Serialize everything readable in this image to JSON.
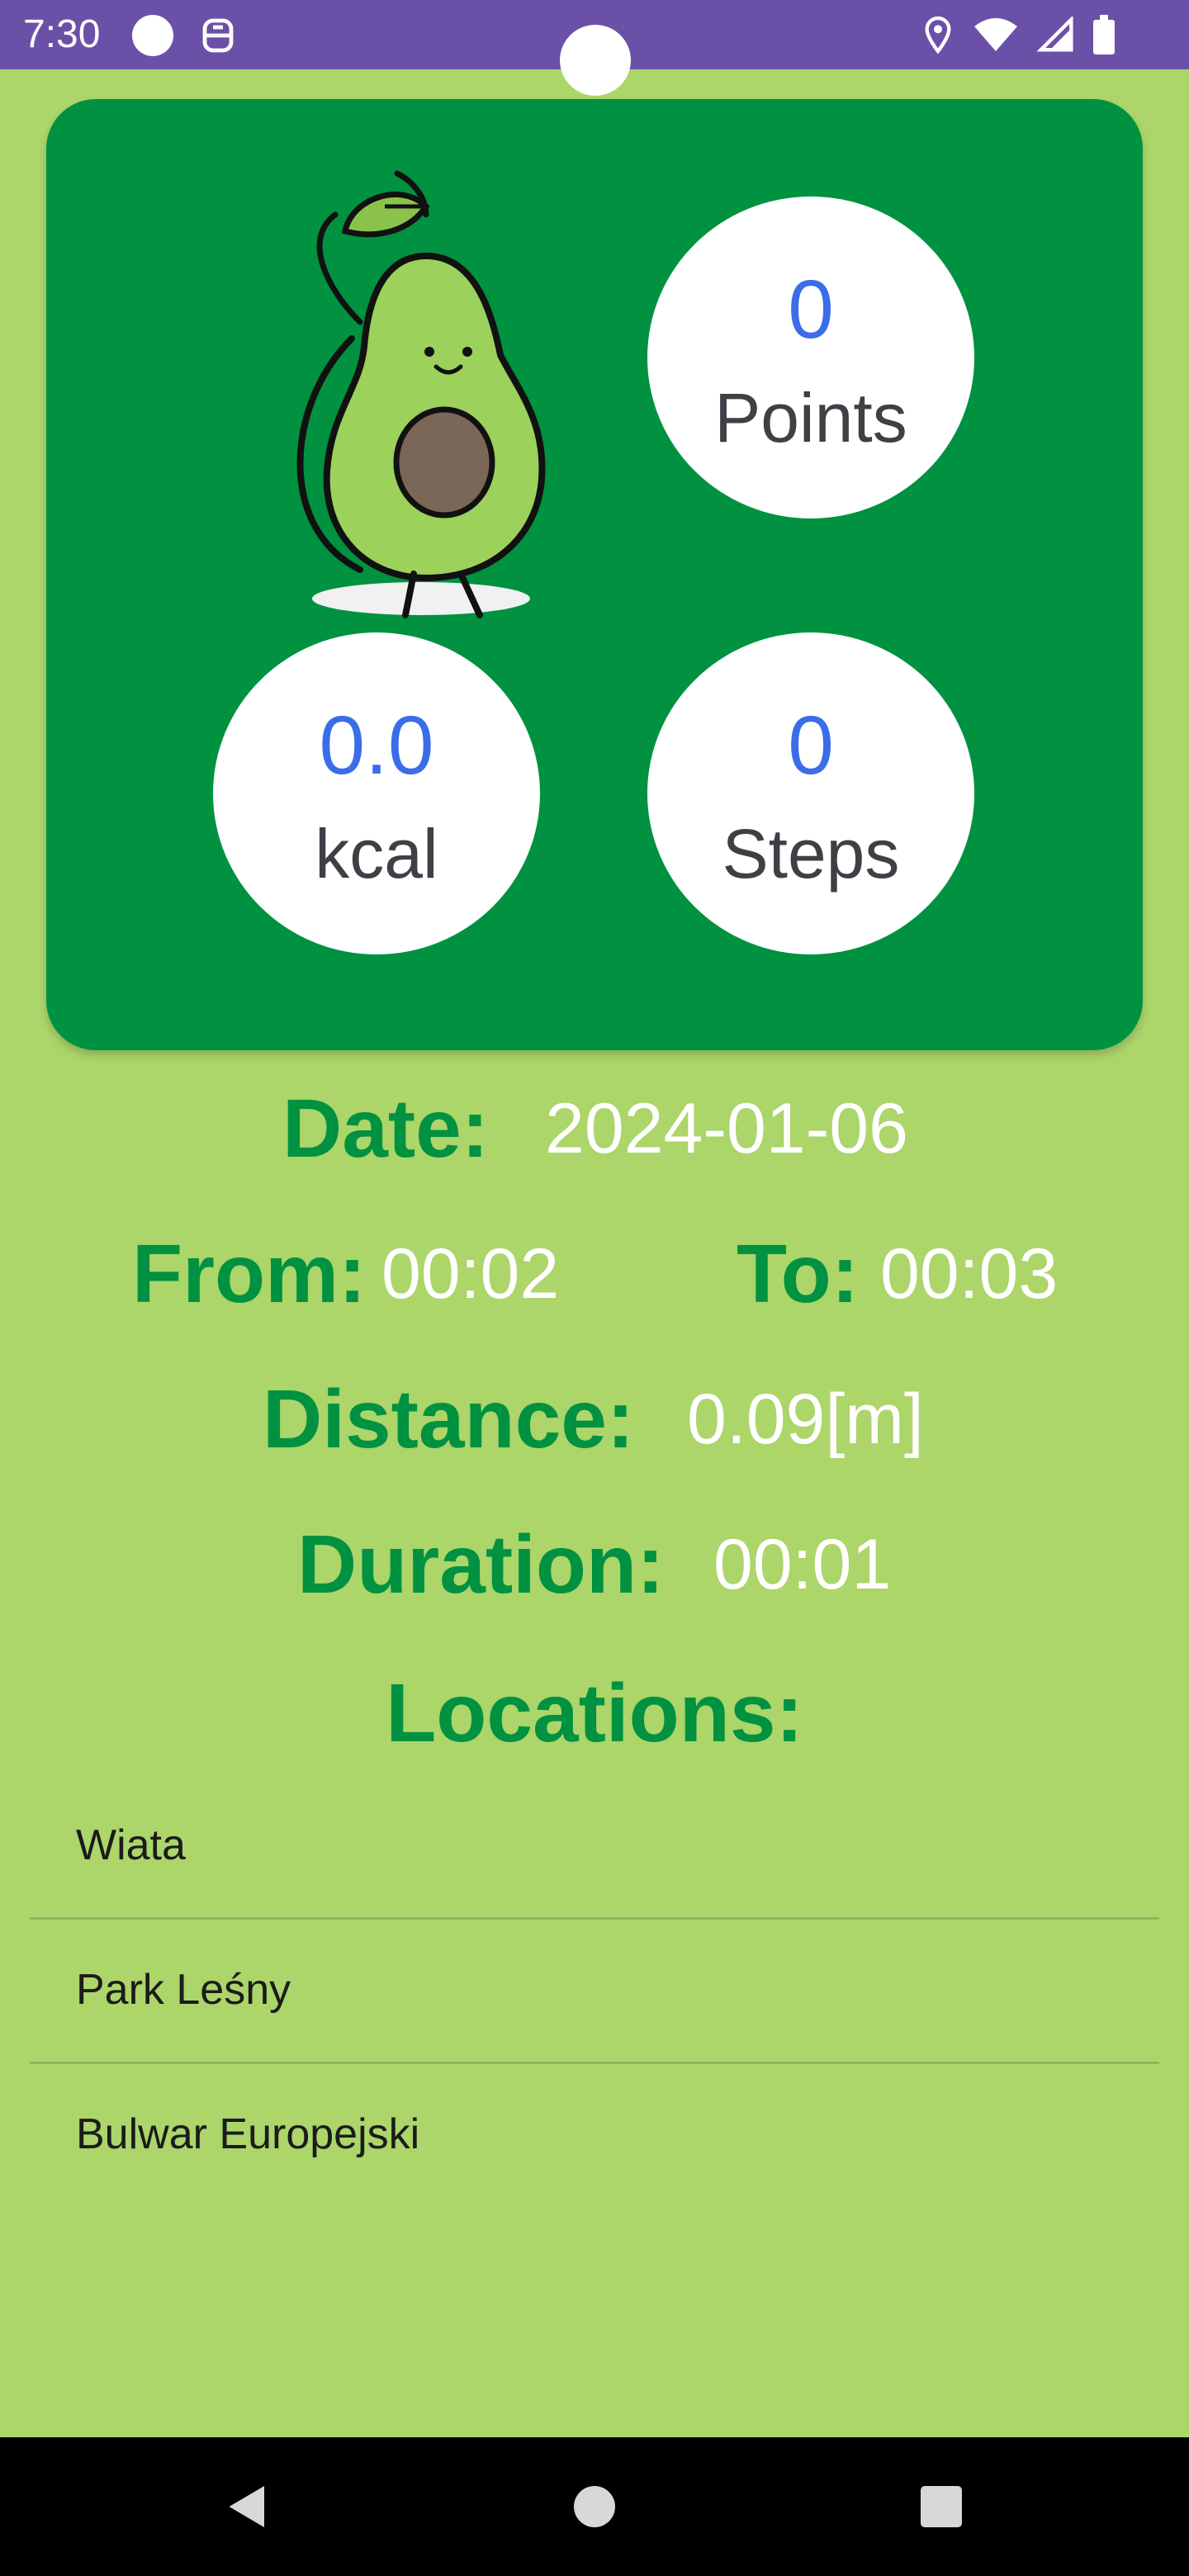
{
  "status_bar": {
    "time": "7:30"
  },
  "stats": {
    "points": {
      "value": "0",
      "label": "Points"
    },
    "kcal": {
      "value": "0.0",
      "label": "kcal"
    },
    "steps": {
      "value": "0",
      "label": "Steps"
    }
  },
  "details": {
    "date_label": "Date:",
    "date_value": "2024-01-06",
    "from_label": "From:",
    "from_value": "00:02",
    "to_label": "To:",
    "to_value": "00:03",
    "distance_label": "Distance:",
    "distance_value": "0.09[m]",
    "duration_label": "Duration:",
    "duration_value": "00:01"
  },
  "locations": {
    "title": "Locations:",
    "items": [
      "Wiata",
      "Park Leśny",
      "Bulwar Europejski"
    ]
  },
  "colors": {
    "status_bar": "#6b50a8",
    "background": "#acd56a",
    "card": "#009240",
    "stat_value": "#3b6de9"
  },
  "icons": [
    "location-icon",
    "wifi-icon",
    "signal-icon",
    "battery-icon",
    "back-icon",
    "home-icon",
    "recents-icon",
    "avocado-mascot-icon"
  ]
}
